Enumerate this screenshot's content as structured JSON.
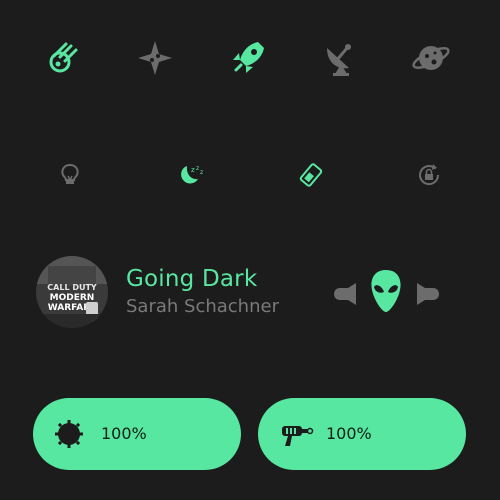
{
  "colors": {
    "background": "#1c1c1c",
    "accent": "#58e7a0",
    "muted_icon": "#6c6c6c",
    "pill_text": "#0e1f17"
  },
  "top_row": {
    "icons": [
      "comet-icon",
      "shuriken-icon",
      "rocket-icon",
      "satellite-dish-icon",
      "planet-icon"
    ],
    "active": "rocket-icon"
  },
  "quick_toggles": {
    "icons": [
      "lightbulb-icon",
      "moon-sleep-icon",
      "battery-saver-icon",
      "rotation-lock-icon"
    ],
    "active": [
      "moon-sleep-icon",
      "battery-saver-icon"
    ]
  },
  "media": {
    "album_art_text": [
      "CALL DUTY",
      "MODERN",
      "WARFARE"
    ],
    "title": "Going Dark",
    "artist": "Sarah Schachner"
  },
  "controls": {
    "prev_icon": "previous-icon",
    "play_icon": "alien-head-icon",
    "next_icon": "next-icon"
  },
  "pills": [
    {
      "icon": "device-icon",
      "value": "100%"
    },
    {
      "icon": "ray-gun-icon",
      "value": "100%"
    }
  ]
}
